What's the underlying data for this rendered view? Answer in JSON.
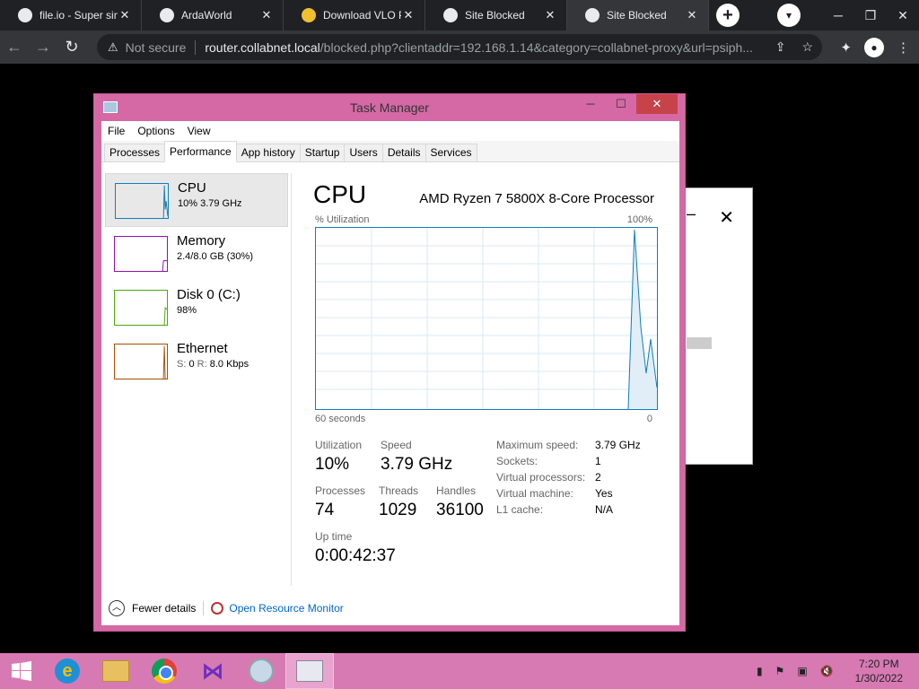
{
  "browser": {
    "tabs": [
      {
        "title": "file.io - Super sim",
        "icon": "globe-icon"
      },
      {
        "title": "ArdaWorld",
        "icon": "globe-icon"
      },
      {
        "title": "Download VLO Pl",
        "icon": "app-icon"
      },
      {
        "title": "Site Blocked",
        "icon": "globe-icon"
      },
      {
        "title": "Site Blocked",
        "icon": "globe-icon",
        "active": true
      }
    ],
    "close_glyph": "✕",
    "new_tab_glyph": "+",
    "security": "Not secure",
    "url_host": "router.collabnet.local",
    "url_path": "/blocked.php?clientaddr=192.168.1.14&category=collabnet-proxy&url=psiph..."
  },
  "task_manager": {
    "title": "Task Manager",
    "menu": [
      "File",
      "Options",
      "View"
    ],
    "tabs": [
      "Processes",
      "Performance",
      "App history",
      "Startup",
      "Users",
      "Details",
      "Services"
    ],
    "active_tab": "Performance",
    "resources": [
      {
        "name": "CPU",
        "value": "10% 3.79 GHz",
        "color": "#117dbb"
      },
      {
        "name": "Memory",
        "value": "2.4/8.0 GB (30%)",
        "color": "#8b12ae"
      },
      {
        "name": "Disk 0 (C:)",
        "value": "98%",
        "color": "#4da60c"
      },
      {
        "name": "Ethernet",
        "value_s_label": "S:",
        "value_s": "0",
        "value_r_label": "R:",
        "value_r": "8.0 Kbps",
        "color": "#a74f01"
      }
    ],
    "detail": {
      "heading": "CPU",
      "processor": "AMD Ryzen 7 5800X 8-Core Processor",
      "y_label": "% Utilization",
      "y_max": "100%",
      "x_left": "60 seconds",
      "x_right": "0",
      "utilization_label": "Utilization",
      "utilization": "10%",
      "speed_label": "Speed",
      "speed": "3.79 GHz",
      "processes_label": "Processes",
      "processes": "74",
      "threads_label": "Threads",
      "threads": "1029",
      "handles_label": "Handles",
      "handles": "36100",
      "uptime_label": "Up time",
      "uptime": "0:00:42:37",
      "specs": [
        {
          "label": "Maximum speed:",
          "value": "3.79 GHz"
        },
        {
          "label": "Sockets:",
          "value": "1"
        },
        {
          "label": "Virtual processors:",
          "value": "2"
        },
        {
          "label": "Virtual machine:",
          "value": "Yes"
        },
        {
          "label": "L1 cache:",
          "value": "N/A"
        }
      ]
    },
    "footer": {
      "fewer_details": "Fewer details",
      "open_resource_monitor": "Open Resource Monitor"
    }
  },
  "taskbar": {
    "time": "7:20 PM",
    "date": "1/30/2022"
  }
}
